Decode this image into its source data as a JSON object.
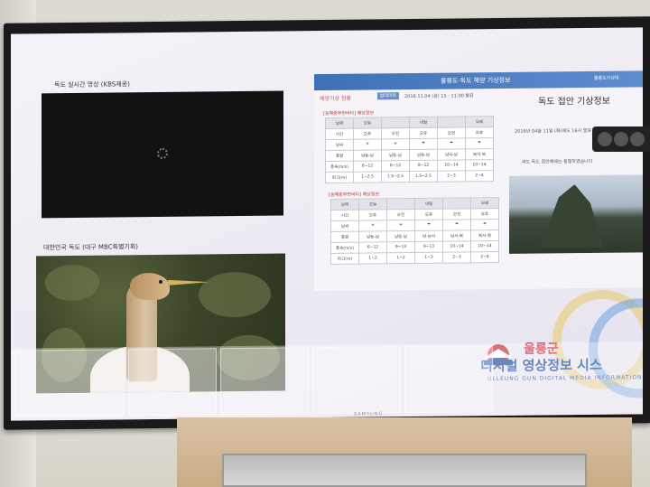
{
  "display": {
    "brand": "SAMSUNG"
  },
  "left_panel": {
    "live_caption": "독도 실시간 영상 (KBS제공)",
    "photo_caption": "대한민국 독도 (대구 MBC특별기획)"
  },
  "weather_panel": {
    "header": "울릉도·독도 해양 기상정보",
    "header_right": "울릉도기상대",
    "tab": "해양기상 현황",
    "button": "업데이트",
    "date": "2016.11.04 (금) 15 : 11:00 발표",
    "title": "독도 접안 기상정보",
    "section1": "[동해중부먼바다] 해상정보",
    "section2": "[동해중부먼바다] 해상정보",
    "table_header": [
      "날짜",
      "오늘",
      "",
      "내일",
      "",
      "모레"
    ],
    "table_rows": [
      [
        "시간",
        "오후",
        "오전",
        "오후",
        "오전",
        "오후"
      ],
      [
        "날씨",
        "☀",
        "☀",
        "☂",
        "☂",
        "☂"
      ],
      [
        "풍향",
        "남동-남",
        "남동-남",
        "남동-남",
        "남서-남",
        "북서-북"
      ],
      [
        "풍속(m/s)",
        "6~12",
        "6~12",
        "8~12",
        "10~14",
        "10~14"
      ],
      [
        "파고(m)",
        "1~2.5",
        "1.5~2.5",
        "1.5~2.5",
        "2~3",
        "2~4"
      ]
    ],
    "table2_rows": [
      [
        "시간",
        "오후",
        "오전",
        "오후",
        "오전",
        "오후"
      ],
      [
        "날씨",
        "☀",
        "☀",
        "☂",
        "☂",
        "☂"
      ],
      [
        "풍향",
        "남동-남",
        "남동-남",
        "남-남서",
        "남서-북",
        "북서-북"
      ],
      [
        "풍속(m/s)",
        "6~12",
        "9~13",
        "9~13",
        "10~14",
        "10~14"
      ],
      [
        "파고(m)",
        "1~2",
        "1~2",
        "1~3",
        "2~3",
        "2~4"
      ]
    ],
    "note": "2016년 04월 11일 (화)에도 16시 발표 독도 접안 여부",
    "note2": "파도 독도 접안해에는 통행하였습니다"
  },
  "logo": {
    "line1": "울릉군",
    "line2": "디지털 영상정보 시스",
    "line3": "ULLEUNG GUN DIGITAL MEDIA INFORMATION"
  }
}
